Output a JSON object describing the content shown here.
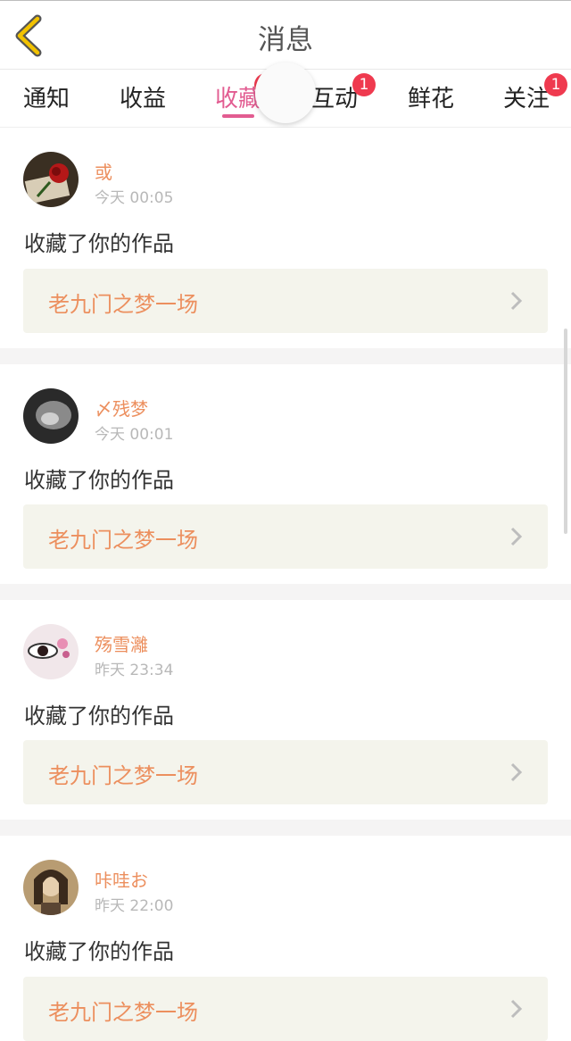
{
  "header": {
    "title": "消息",
    "back_icon": "chevron-left-icon",
    "accent": "#f2c200"
  },
  "tabs": [
    {
      "label": "通知",
      "badge": ""
    },
    {
      "label": "收益",
      "badge": ""
    },
    {
      "label": "收藏",
      "badge": "",
      "active": true
    },
    {
      "label": "互动",
      "badge": "1"
    },
    {
      "label": "鲜花",
      "badge": ""
    },
    {
      "label": "关注",
      "badge": "1"
    }
  ],
  "feed": [
    {
      "user": "或",
      "time": "今天 00:05",
      "action": "收藏了你的作品",
      "work": "老九门之梦一场"
    },
    {
      "user": "〆残梦",
      "time": "今天 00:01",
      "action": "收藏了你的作品",
      "work": "老九门之梦一场"
    },
    {
      "user": "殇雪灕",
      "time": "昨天 23:34",
      "action": "收藏了你的作品",
      "work": "老九门之梦一场"
    },
    {
      "user": "咔哇お",
      "time": "昨天 22:00",
      "action": "收藏了你的作品",
      "work": "老九门之梦一场"
    }
  ],
  "colors": {
    "active_tab": "#e25c91",
    "badge": "#ef3a4f",
    "username": "#ec8f5e"
  }
}
